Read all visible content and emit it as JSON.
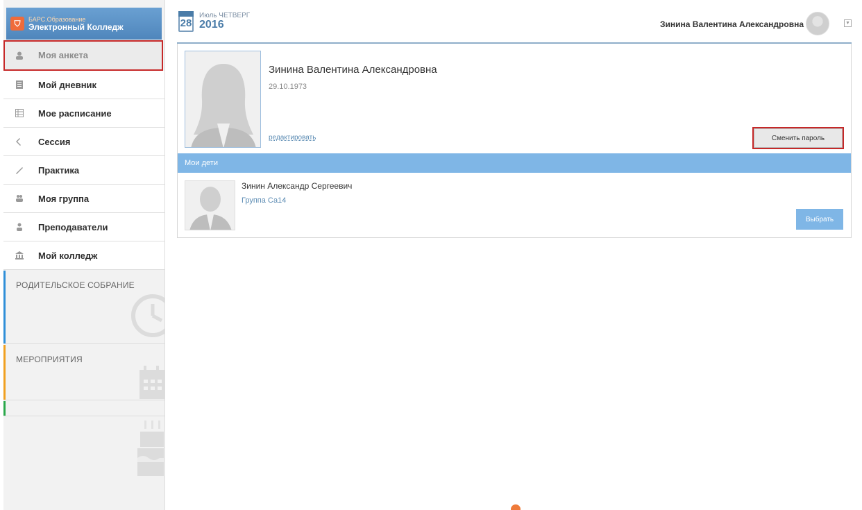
{
  "sidebar": {
    "logo": {
      "line1": "БАРС.Образование",
      "line2": "Электронный Колледж",
      "brand_color": "#ef6b3a"
    },
    "items": [
      {
        "label": "Моя анкета",
        "icon": "person-icon"
      },
      {
        "label": "Мой дневник",
        "icon": "diary-icon"
      },
      {
        "label": "Мое расписание",
        "icon": "schedule-icon"
      },
      {
        "label": "Сессия",
        "icon": "session-icon"
      },
      {
        "label": "Практика",
        "icon": "practice-icon"
      },
      {
        "label": "Моя группа",
        "icon": "group-icon"
      },
      {
        "label": "Преподаватели",
        "icon": "teachers-icon"
      },
      {
        "label": "Мой колледж",
        "icon": "college-icon"
      }
    ],
    "sections": [
      {
        "title": "РОДИТЕЛЬСКОЕ СОБРАНИЕ",
        "color": "#2f8fd8",
        "icon": "clock-icon"
      },
      {
        "title": "МЕРОПРИЯТИЯ",
        "color": "#f0a020",
        "icon": "calendar-icon"
      },
      {
        "title": "",
        "color": "#2aa84a",
        "icon": "cake-icon"
      }
    ]
  },
  "header": {
    "day": "28",
    "month_weekday": "Июль ЧЕТВЕРГ",
    "year": "2016",
    "user_name": "Зинина Валентина Александровна"
  },
  "profile": {
    "name": "Зинина Валентина Александровна",
    "dob": "29.10.1973",
    "edit_label": "редактировать",
    "change_password_label": "Сменить пароль"
  },
  "children": {
    "title": "Мои дети",
    "items": [
      {
        "name": "Зинин Александр Сергеевич",
        "group": "Группа Са14",
        "choose_label": "Выбрать"
      }
    ]
  },
  "colors": {
    "accent": "#7fb6e6",
    "highlight_border": "#c62828",
    "link": "#5b8bb3"
  }
}
